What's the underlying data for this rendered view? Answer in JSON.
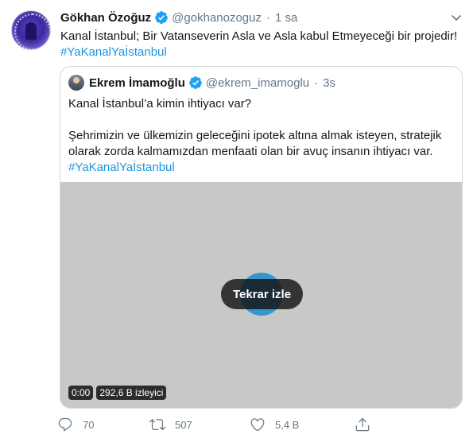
{
  "tweet": {
    "author_name": "Gökhan Özoğuz",
    "handle": "@gokhanozoguz",
    "separator": "·",
    "time": "1 sa",
    "text": "Kanal İstanbul; Bir Vatanseverin Asla ve Asla kabul Etmeyeceği bir projedir!",
    "hashtag": "#YaKanalYaİstanbul"
  },
  "quote": {
    "author_name": "Ekrem İmamoğlu",
    "handle": "@ekrem_imamoglu",
    "separator": "·",
    "time": "3s",
    "line1": "Kanal İstanbul’a kimin ihtiyacı var?",
    "line2": "Şehrimizin ve ülkemizin geleceğini ipotek altına almak isteyen, stratejik olarak zorda kalmamızdan menfaati olan bir avuç insanın ihtiyacı var.",
    "hashtag": "#YaKanalYaİstanbul"
  },
  "video": {
    "replay_label": "Tekrar izle",
    "duration": "0:00",
    "views": "292,6 B izleyici"
  },
  "actions": {
    "replies": "70",
    "retweets": "507",
    "likes": "5,4 B"
  },
  "colors": {
    "verified": "#1da1f2",
    "hashtag": "#1b95e0",
    "muted": "#657786",
    "play": "#1d8ccf"
  },
  "icons": {
    "verified": "verified-badge-icon",
    "caret": "chevron-down-icon",
    "reply": "reply-icon",
    "retweet": "retweet-icon",
    "like": "heart-icon",
    "share": "share-icon"
  }
}
